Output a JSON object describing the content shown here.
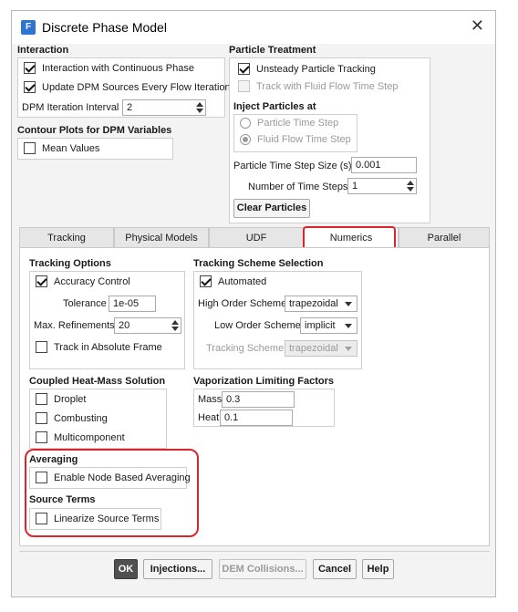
{
  "window": {
    "title": "Discrete Phase Model",
    "icon_letter": "F"
  },
  "interaction": {
    "title": "Interaction",
    "continuous_phase_label": "Interaction with Continuous Phase",
    "continuous_phase_checked": true,
    "update_sources_label": "Update DPM Sources Every Flow Iteration",
    "update_sources_checked": true,
    "iteration_interval_label": "DPM Iteration Interval",
    "iteration_interval_value": "2"
  },
  "contour": {
    "title": "Contour Plots for DPM Variables",
    "mean_values_label": "Mean Values",
    "mean_values_checked": false
  },
  "particle_treatment": {
    "title": "Particle Treatment",
    "unsteady_label": "Unsteady Particle Tracking",
    "unsteady_checked": true,
    "fluid_time_step_label": "Track with Fluid Flow Time Step",
    "fluid_time_step_checked": false,
    "inject_title": "Inject Particles at",
    "particle_time_step_label": "Particle Time Step",
    "fluid_flow_time_step_label": "Fluid Flow Time Step",
    "selected_inject": "fluid",
    "time_step_size_label": "Particle Time Step Size (s)",
    "time_step_size_value": "0.001",
    "num_time_steps_label": "Number of Time Steps",
    "num_time_steps_value": "1",
    "clear_particles_label": "Clear Particles"
  },
  "tabs": [
    {
      "label": "Tracking"
    },
    {
      "label": "Physical Models"
    },
    {
      "label": "UDF"
    },
    {
      "label": "Numerics"
    },
    {
      "label": "Parallel"
    }
  ],
  "active_tab": "Numerics",
  "tracking_options": {
    "title": "Tracking Options",
    "accuracy_control_label": "Accuracy Control",
    "accuracy_control_checked": true,
    "tolerance_label": "Tolerance",
    "tolerance_value": "1e-05",
    "max_refinements_label": "Max. Refinements",
    "max_refinements_value": "20",
    "absolute_frame_label": "Track in Absolute Frame",
    "absolute_frame_checked": false
  },
  "tracking_scheme": {
    "title": "Tracking Scheme Selection",
    "automated_label": "Automated",
    "automated_checked": true,
    "high_order_label": "High Order Scheme",
    "high_order_value": "trapezoidal",
    "low_order_label": "Low Order Scheme",
    "low_order_value": "implicit",
    "tracking_scheme_label": "Tracking Scheme",
    "tracking_scheme_value": "trapezoidal"
  },
  "coupled": {
    "title": "Coupled Heat-Mass Solution",
    "droplet_label": "Droplet",
    "combusting_label": "Combusting",
    "multicomponent_label": "Multicomponent"
  },
  "vaporization": {
    "title": "Vaporization Limiting Factors",
    "mass_label": "Mass",
    "mass_value": "0.3",
    "heat_label": "Heat",
    "heat_value": "0.1"
  },
  "averaging": {
    "title": "Averaging",
    "node_based_label": "Enable Node Based Averaging",
    "node_based_checked": false
  },
  "source_terms": {
    "title": "Source Terms",
    "linearize_label": "Linearize Source Terms",
    "linearize_checked": false
  },
  "buttons": {
    "ok": "OK",
    "injections": "Injections...",
    "dem_collisions": "DEM Collisions...",
    "cancel": "Cancel",
    "help": "Help"
  },
  "colors": {
    "highlight": "#d9262c",
    "primary_button": "#505050"
  }
}
